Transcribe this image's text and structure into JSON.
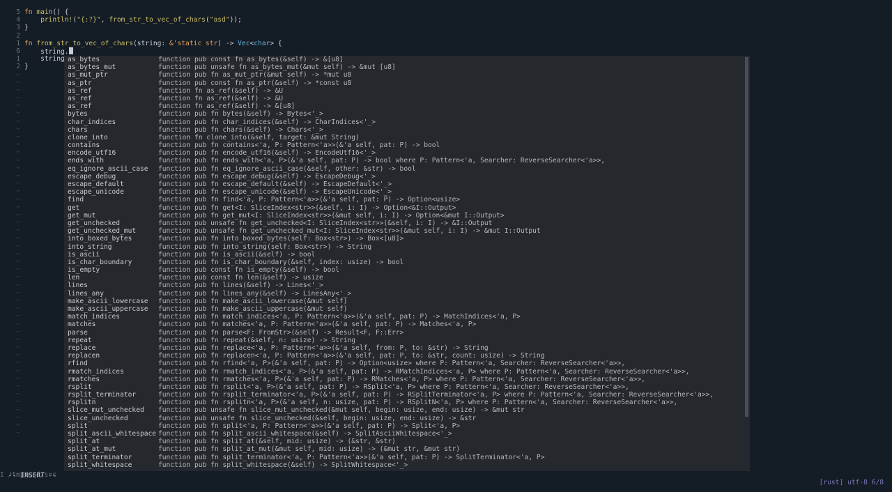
{
  "editor": {
    "lines": [
      {
        "num": "5",
        "type": "main_fn",
        "tokens": [
          "fn",
          "main",
          "() {"
        ]
      },
      {
        "num": "4",
        "type": "println",
        "tokens": [
          "println!",
          "(",
          "\"{:?}\"",
          ", ",
          "from_str_to_vec_of_chars",
          "(",
          "\"asd\"",
          "));"
        ]
      },
      {
        "num": "3",
        "type": "plain",
        "text": "}"
      },
      {
        "num": "2",
        "type": "plain",
        "text": ""
      },
      {
        "num": "1",
        "type": "sig",
        "tokens": [
          "fn",
          "from_str_to_vec_of_chars",
          "(string: ",
          "&'static str",
          ") -> ",
          "Vec",
          "<",
          "char",
          "> {"
        ]
      },
      {
        "num": "6",
        "type": "current",
        "text": "    string."
      },
      {
        "num": "1",
        "type": "plain",
        "text": "    string"
      },
      {
        "num": "2",
        "type": "plain",
        "text": "}"
      },
      {
        "num": "~",
        "type": "tilde"
      },
      {
        "num": "~",
        "type": "tilde"
      },
      {
        "num": "~",
        "type": "tilde"
      },
      {
        "num": "~",
        "type": "tilde"
      },
      {
        "num": "~",
        "type": "tilde"
      },
      {
        "num": "~",
        "type": "tilde"
      },
      {
        "num": "~",
        "type": "tilde"
      },
      {
        "num": "~",
        "type": "tilde"
      },
      {
        "num": "~",
        "type": "tilde"
      },
      {
        "num": "~",
        "type": "tilde"
      },
      {
        "num": "~",
        "type": "tilde"
      },
      {
        "num": "~",
        "type": "tilde"
      },
      {
        "num": "~",
        "type": "tilde"
      },
      {
        "num": "~",
        "type": "tilde"
      },
      {
        "num": "~",
        "type": "tilde"
      },
      {
        "num": "~",
        "type": "tilde"
      },
      {
        "num": "~",
        "type": "tilde"
      },
      {
        "num": "~",
        "type": "tilde"
      },
      {
        "num": "~",
        "type": "tilde"
      },
      {
        "num": "~",
        "type": "tilde"
      },
      {
        "num": "~",
        "type": "tilde"
      },
      {
        "num": "~",
        "type": "tilde"
      },
      {
        "num": "~",
        "type": "tilde"
      },
      {
        "num": "~",
        "type": "tilde"
      },
      {
        "num": "~",
        "type": "tilde"
      },
      {
        "num": "~",
        "type": "tilde"
      },
      {
        "num": "~",
        "type": "tilde"
      },
      {
        "num": "~",
        "type": "tilde"
      },
      {
        "num": "~",
        "type": "tilde"
      },
      {
        "num": "~",
        "type": "tilde"
      },
      {
        "num": "~",
        "type": "tilde"
      },
      {
        "num": "~",
        "type": "tilde"
      },
      {
        "num": "~",
        "type": "tilde"
      },
      {
        "num": "~",
        "type": "tilde"
      },
      {
        "num": "~",
        "type": "tilde"
      },
      {
        "num": "~",
        "type": "tilde"
      },
      {
        "num": "~",
        "type": "tilde"
      },
      {
        "num": "~",
        "type": "tilde"
      },
      {
        "num": "~",
        "type": "tilde"
      },
      {
        "num": "~",
        "type": "tilde"
      },
      {
        "num": "~",
        "type": "tilde"
      },
      {
        "num": "~",
        "type": "tilde"
      },
      {
        "num": "~",
        "type": "tilde"
      },
      {
        "num": "~",
        "type": "tilde"
      },
      {
        "num": "~",
        "type": "tilde"
      },
      {
        "num": "~",
        "type": "tilde"
      },
      {
        "num": "~",
        "type": "tilde"
      }
    ]
  },
  "statusline": {
    "path": "I /tmp/asd/src",
    "right": "[rust] utf-8 6/8"
  },
  "mode": "-- INSERT --",
  "completion": {
    "items": [
      {
        "name": "as_bytes",
        "sig": "function pub const fn as_bytes(&self) -> &[u8]"
      },
      {
        "name": "as_bytes_mut",
        "sig": "function pub unsafe fn as_bytes_mut(&mut self) -> &mut [u8]"
      },
      {
        "name": "as_mut_ptr",
        "sig": "function pub fn as_mut_ptr(&mut self) -> *mut u8"
      },
      {
        "name": "as_ptr",
        "sig": "function pub const fn as_ptr(&self) -> *const u8"
      },
      {
        "name": "as_ref",
        "sig": "function fn as_ref(&self) -> &U"
      },
      {
        "name": "as_ref",
        "sig": "function fn as_ref(&self) -> &U"
      },
      {
        "name": "as_ref",
        "sig": "function fn as_ref(&self) -> &[u8]"
      },
      {
        "name": "bytes",
        "sig": "function pub fn bytes(&self) -> Bytes<'_>"
      },
      {
        "name": "char_indices",
        "sig": "function pub fn char_indices(&self) -> CharIndices<'_>"
      },
      {
        "name": "chars",
        "sig": "function pub fn chars(&self) -> Chars<'_>"
      },
      {
        "name": "clone_into",
        "sig": "function fn clone_into(&self, target: &mut String)"
      },
      {
        "name": "contains",
        "sig": "function pub fn contains<'a, P: Pattern<'a>>(&'a self, pat: P) -> bool"
      },
      {
        "name": "encode_utf16",
        "sig": "function pub fn encode_utf16(&self) -> EncodeUtf16<'_>"
      },
      {
        "name": "ends_with",
        "sig": "function pub fn ends_with<'a, P>(&'a self, pat: P) -> bool where P: Pattern<'a, Searcher: ReverseSearcher<'a>>,"
      },
      {
        "name": "eq_ignore_ascii_case",
        "sig": "function pub fn eq_ignore_ascii_case(&self, other: &str) -> bool"
      },
      {
        "name": "escape_debug",
        "sig": "function pub fn escape_debug(&self) -> EscapeDebug<'_>"
      },
      {
        "name": "escape_default",
        "sig": "function pub fn escape_default(&self) -> EscapeDefault<'_>"
      },
      {
        "name": "escape_unicode",
        "sig": "function pub fn escape_unicode(&self) -> EscapeUnicode<'_>"
      },
      {
        "name": "find",
        "sig": "function pub fn find<'a, P: Pattern<'a>>(&'a self, pat: P) -> Option<usize>"
      },
      {
        "name": "get",
        "sig": "function pub fn get<I: SliceIndex<str>>(&self, i: I) -> Option<&I::Output>"
      },
      {
        "name": "get_mut",
        "sig": "function pub fn get_mut<I: SliceIndex<str>>(&mut self, i: I) -> Option<&mut I::Output>"
      },
      {
        "name": "get_unchecked",
        "sig": "function pub unsafe fn get_unchecked<I: SliceIndex<str>>(&self, i: I) -> &I::Output"
      },
      {
        "name": "get_unchecked_mut",
        "sig": "function pub unsafe fn get_unchecked_mut<I: SliceIndex<str>>(&mut self, i: I) -> &mut I::Output"
      },
      {
        "name": "into_boxed_bytes",
        "sig": "function pub fn into_boxed_bytes(self: Box<str>) -> Box<[u8]>"
      },
      {
        "name": "into_string",
        "sig": "function pub fn into_string(self: Box<str>) -> String"
      },
      {
        "name": "is_ascii",
        "sig": "function pub fn is_ascii(&self) -> bool"
      },
      {
        "name": "is_char_boundary",
        "sig": "function pub fn is_char_boundary(&self, index: usize) -> bool"
      },
      {
        "name": "is_empty",
        "sig": "function pub const fn is_empty(&self) -> bool"
      },
      {
        "name": "len",
        "sig": "function pub const fn len(&self) -> usize"
      },
      {
        "name": "lines",
        "sig": "function pub fn lines(&self) -> Lines<'_>"
      },
      {
        "name": "lines_any",
        "sig": "function pub fn lines_any(&self) -> LinesAny<'_>"
      },
      {
        "name": "make_ascii_lowercase",
        "sig": "function pub fn make_ascii_lowercase(&mut self)"
      },
      {
        "name": "make_ascii_uppercase",
        "sig": "function pub fn make_ascii_uppercase(&mut self)"
      },
      {
        "name": "match_indices",
        "sig": "function pub fn match_indices<'a, P: Pattern<'a>>(&'a self, pat: P) -> MatchIndices<'a, P>"
      },
      {
        "name": "matches",
        "sig": "function pub fn matches<'a, P: Pattern<'a>>(&'a self, pat: P) -> Matches<'a, P>"
      },
      {
        "name": "parse",
        "sig": "function pub fn parse<F: FromStr>(&self) -> Result<F, F::Err>"
      },
      {
        "name": "repeat",
        "sig": "function pub fn repeat(&self, n: usize) -> String"
      },
      {
        "name": "replace",
        "sig": "function pub fn replace<'a, P: Pattern<'a>>(&'a self, from: P, to: &str) -> String"
      },
      {
        "name": "replacen",
        "sig": "function pub fn replacen<'a, P: Pattern<'a>>(&'a self, pat: P, to: &str, count: usize) -> String"
      },
      {
        "name": "rfind",
        "sig": "function pub fn rfind<'a, P>(&'a self, pat: P) -> Option<usize> where P: Pattern<'a, Searcher: ReverseSearcher<'a>>,"
      },
      {
        "name": "rmatch_indices",
        "sig": "function pub fn rmatch_indices<'a, P>(&'a self, pat: P) -> RMatchIndices<'a, P> where P: Pattern<'a, Searcher: ReverseSearcher<'a>>,"
      },
      {
        "name": "rmatches",
        "sig": "function pub fn rmatches<'a, P>(&'a self, pat: P) -> RMatches<'a, P> where P: Pattern<'a, Searcher: ReverseSearcher<'a>>,"
      },
      {
        "name": "rsplit",
        "sig": "function pub fn rsplit<'a, P>(&'a self, pat: P) -> RSplit<'a, P> where P: Pattern<'a, Searcher: ReverseSearcher<'a>>,"
      },
      {
        "name": "rsplit_terminator",
        "sig": "function pub fn rsplit_terminator<'a, P>(&'a self, pat: P) -> RSplitTerminator<'a, P> where P: Pattern<'a, Searcher: ReverseSearcher<'a>>,"
      },
      {
        "name": "rsplitn",
        "sig": "function pub fn rsplitn<'a, P>(&'a self, n: usize, pat: P) -> RSplitN<'a, P> where P: Pattern<'a, Searcher: ReverseSearcher<'a>>,"
      },
      {
        "name": "slice_mut_unchecked",
        "sig": "function pub unsafe fn slice_mut_unchecked(&mut self, begin: usize, end: usize) -> &mut str"
      },
      {
        "name": "slice_unchecked",
        "sig": "function pub unsafe fn slice_unchecked(&self, begin: usize, end: usize) -> &str"
      },
      {
        "name": "split",
        "sig": "function pub fn split<'a, P: Pattern<'a>>(&'a self, pat: P) -> Split<'a, P>"
      },
      {
        "name": "split_ascii_whitespace",
        "sig": "function pub fn split_ascii_whitespace(&self) -> SplitAsciiWhitespace<'_>"
      },
      {
        "name": "split_at",
        "sig": "function pub fn split_at(&self, mid: usize) -> (&str, &str)"
      },
      {
        "name": "split_at_mut",
        "sig": "function pub fn split_at_mut(&mut self, mid: usize) -> (&mut str, &mut str)"
      },
      {
        "name": "split_terminator",
        "sig": "function pub fn split_terminator<'a, P: Pattern<'a>>(&'a self, pat: P) -> SplitTerminator<'a, P>"
      },
      {
        "name": "split_whitespace",
        "sig": "function pub fn split_whitespace(&self) -> SplitWhitespace<'_>"
      }
    ]
  },
  "colors": {
    "background": "#141c26",
    "popup": "#25282d",
    "keyword": "#e0a458",
    "function": "#c8bd63",
    "type": "#6fb5e3",
    "statusline_right": "#7f7ab8"
  }
}
